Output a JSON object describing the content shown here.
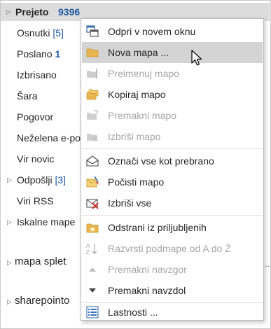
{
  "folders": {
    "inbox_label": "Prejeto",
    "inbox_count": "9396",
    "drafts_label": "Osnutki",
    "drafts_count": "[5]",
    "sent_label": "Poslano",
    "sent_count": "1",
    "deleted_label": "Izbrisano",
    "junk_label": "Šara",
    "conversation_label": "Pogovor",
    "unwanted_label": "Neželena e-po",
    "rss_label": "Vir novic",
    "outbox_label": "Odpošlji",
    "outbox_count": "[3]",
    "rss_feeds_label": "Viri RSS",
    "search_label": "Iskalne mape",
    "group1_label": "mapa splet",
    "group2_label": "sharepointo"
  },
  "menu": {
    "open_new_window": "Odpri v novem oknu",
    "new_folder": "Nova mapa ...",
    "rename_folder": "Preimenuj mapo",
    "copy_folder": "Kopiraj mapo",
    "move_folder": "Premakni mapo",
    "delete_folder": "Izbriši mapo",
    "mark_all_read": "Označi vse kot prebrano",
    "clean_folder": "Počisti mapo",
    "delete_all": "Izbriši vse",
    "remove_favorites": "Odstrani iz priljubljenih",
    "sort_subfolders": "Razvrsti podmape od A do Ž",
    "move_up": "Premakni navzgor",
    "move_down": "Premakni navzdol",
    "properties": "Lastnosti ..."
  },
  "colors": {
    "accent_blue": "#1d57a3",
    "highlight": "#d4d4d4",
    "disabled_text": "#a6a6a6",
    "folder_icon": "#e8b64c"
  }
}
